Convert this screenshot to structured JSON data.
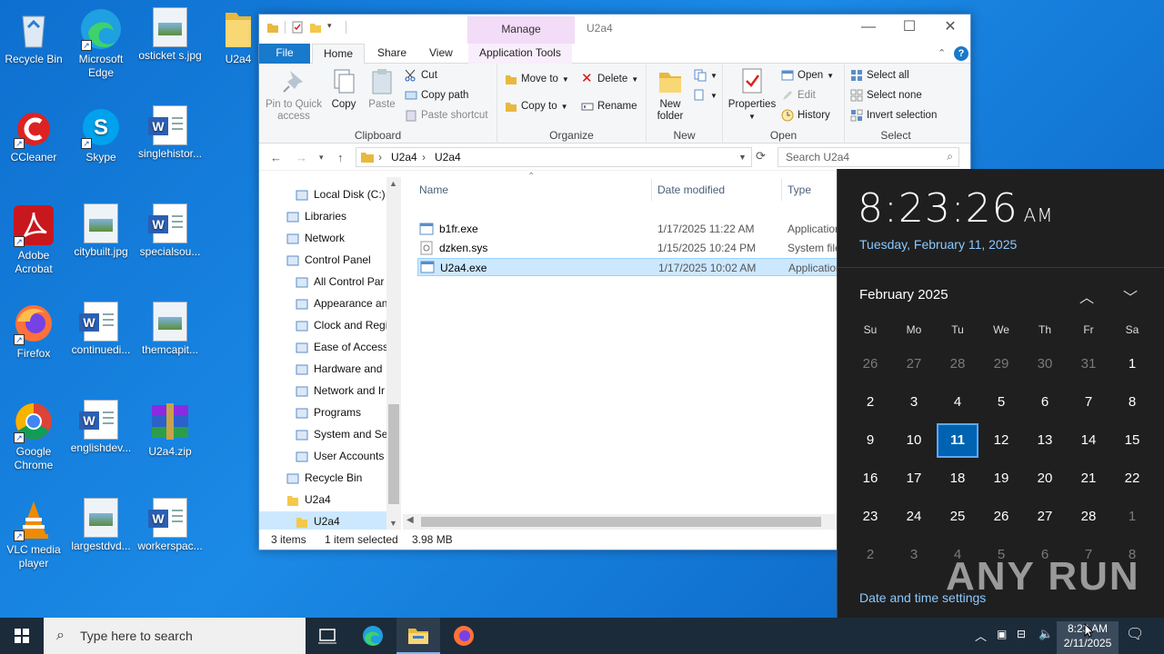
{
  "desktop": {
    "icons": [
      {
        "label": "Recycle Bin",
        "icon": "recycle-bin-icon"
      },
      {
        "label": "Microsoft Edge",
        "icon": "edge-icon"
      },
      {
        "label": "osticket s.jpg",
        "icon": "image-file-icon"
      },
      {
        "label": "U2a4",
        "icon": "folder-icon"
      },
      {
        "label": "CCleaner",
        "icon": "ccleaner-icon"
      },
      {
        "label": "Skype",
        "icon": "skype-icon"
      },
      {
        "label": "singlehistor...",
        "icon": "word-doc-icon"
      },
      {
        "label": "Adobe Acrobat",
        "icon": "acrobat-icon"
      },
      {
        "label": "citybuilt.jpg",
        "icon": "image-file-icon"
      },
      {
        "label": "specialsou...",
        "icon": "word-doc-icon"
      },
      {
        "label": "Firefox",
        "icon": "firefox-icon"
      },
      {
        "label": "continuedi...",
        "icon": "word-doc-icon"
      },
      {
        "label": "themcapit...",
        "icon": "image-file-icon"
      },
      {
        "label": "Google Chrome",
        "icon": "chrome-icon"
      },
      {
        "label": "englishdev...",
        "icon": "word-doc-icon"
      },
      {
        "label": "U2a4.zip",
        "icon": "winrar-icon"
      },
      {
        "label": "VLC media player",
        "icon": "vlc-icon"
      },
      {
        "label": "largestdvd...",
        "icon": "image-file-icon"
      },
      {
        "label": "workerspac...",
        "icon": "word-doc-icon"
      }
    ]
  },
  "explorer": {
    "title": "U2a4",
    "context_tab": "Manage",
    "tabs": {
      "file": "File",
      "home": "Home",
      "share": "Share",
      "view": "View",
      "app_tools": "Application Tools"
    },
    "ribbon": {
      "clipboard": {
        "label": "Clipboard",
        "pin": "Pin to Quick access",
        "copy": "Copy",
        "paste": "Paste",
        "cut": "Cut",
        "copy_path": "Copy path",
        "paste_shortcut": "Paste shortcut"
      },
      "organize": {
        "label": "Organize",
        "move_to": "Move to",
        "copy_to": "Copy to",
        "delete": "Delete",
        "rename": "Rename"
      },
      "new": {
        "label": "New",
        "new_folder": "New folder"
      },
      "open": {
        "label": "Open",
        "properties": "Properties",
        "open": "Open",
        "edit": "Edit",
        "history": "History"
      },
      "select": {
        "label": "Select",
        "select_all": "Select all",
        "select_none": "Select none",
        "invert": "Invert selection"
      }
    },
    "address": {
      "seg1": "U2a4",
      "seg2": "U2a4",
      "search_placeholder": "Search U2a4"
    },
    "nav": [
      {
        "label": "Local Disk (C:)",
        "indent": 1
      },
      {
        "label": "Libraries",
        "indent": 0
      },
      {
        "label": "Network",
        "indent": 0
      },
      {
        "label": "Control Panel",
        "indent": 0
      },
      {
        "label": "All Control Par",
        "indent": 1
      },
      {
        "label": "Appearance an",
        "indent": 1
      },
      {
        "label": "Clock and Regi",
        "indent": 1
      },
      {
        "label": "Ease of Access",
        "indent": 1
      },
      {
        "label": "Hardware and",
        "indent": 1
      },
      {
        "label": "Network and Ir",
        "indent": 1
      },
      {
        "label": "Programs",
        "indent": 1
      },
      {
        "label": "System and Sec",
        "indent": 1
      },
      {
        "label": "User Accounts",
        "indent": 1
      },
      {
        "label": "Recycle Bin",
        "indent": 0
      },
      {
        "label": "U2a4",
        "indent": 0
      },
      {
        "label": "U2a4",
        "indent": 1
      }
    ],
    "columns": {
      "name": "Name",
      "date": "Date modified",
      "type": "Type"
    },
    "files": [
      {
        "name": "b1fr.exe",
        "date": "1/17/2025 11:22 AM",
        "type": "Application"
      },
      {
        "name": "dzken.sys",
        "date": "1/15/2025 10:24 PM",
        "type": "System file"
      },
      {
        "name": "U2a4.exe",
        "date": "1/17/2025 10:02 AM",
        "type": "Application"
      }
    ],
    "status": {
      "items": "3 items",
      "selected": "1 item selected",
      "size": "3.98 MB"
    }
  },
  "clock_flyout": {
    "time": "8:23:26",
    "ampm": "AM",
    "date": "Tuesday, February 11, 2025",
    "month": "February 2025",
    "weekdays": [
      "Su",
      "Mo",
      "Tu",
      "We",
      "Th",
      "Fr",
      "Sa"
    ],
    "days": [
      [
        "26",
        "27",
        "28",
        "29",
        "30",
        "31",
        "1"
      ],
      [
        "2",
        "3",
        "4",
        "5",
        "6",
        "7",
        "8"
      ],
      [
        "9",
        "10",
        "11",
        "12",
        "13",
        "14",
        "15"
      ],
      [
        "16",
        "17",
        "18",
        "19",
        "20",
        "21",
        "22"
      ],
      [
        "23",
        "24",
        "25",
        "26",
        "27",
        "28",
        "1"
      ],
      [
        "2",
        "3",
        "4",
        "5",
        "6",
        "7",
        "8"
      ]
    ],
    "today": "11",
    "settings_link": "Date and time settings"
  },
  "watermark": "ANY RUN",
  "taskbar": {
    "search_placeholder": "Type here to search",
    "clock_time": "8:23 AM",
    "clock_date": "2/11/2025"
  },
  "colors": {
    "accent": "#0063b1",
    "link": "#8cc8ff",
    "file_tab": "#1979ca",
    "selection": "#cce8ff"
  }
}
